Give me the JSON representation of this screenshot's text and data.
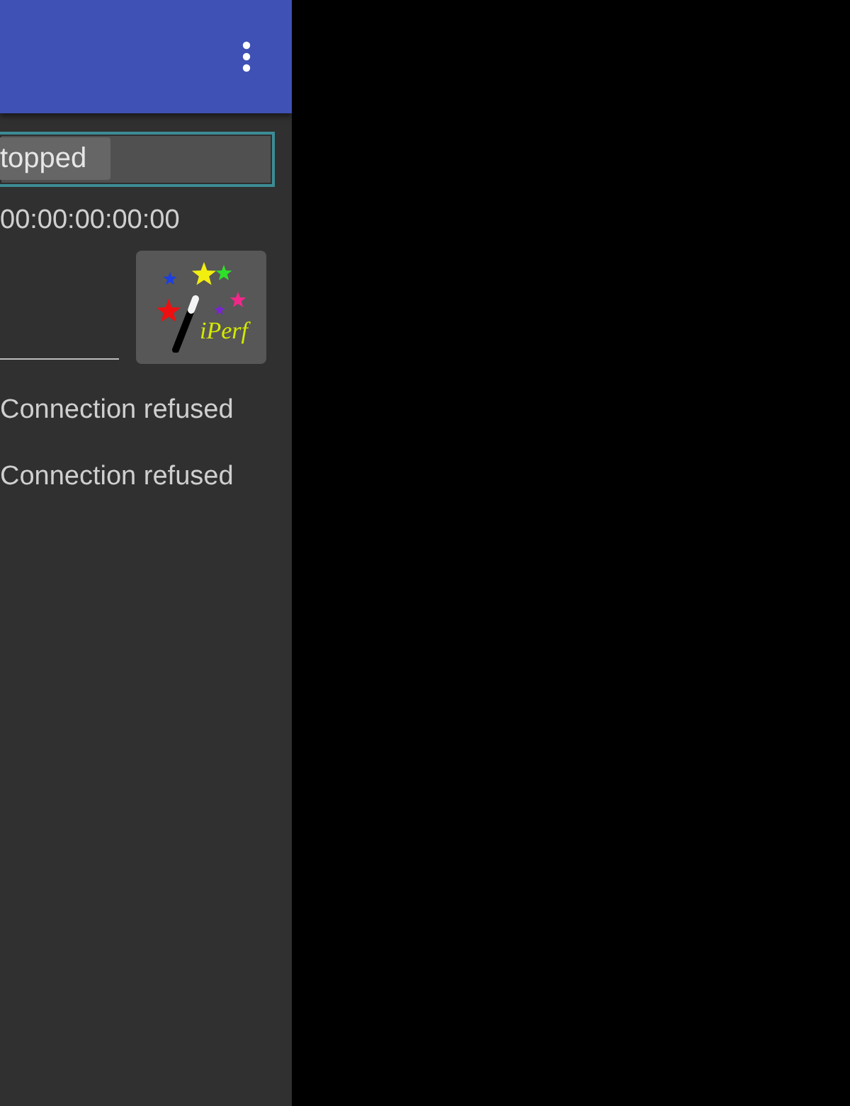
{
  "status_field": {
    "button_label": "topped"
  },
  "address": "00:00:00:00:00",
  "logo": {
    "text": "iPerf"
  },
  "log": [
    {
      "text": "Connection refused"
    },
    {
      "text": "Connection refused"
    }
  ]
}
